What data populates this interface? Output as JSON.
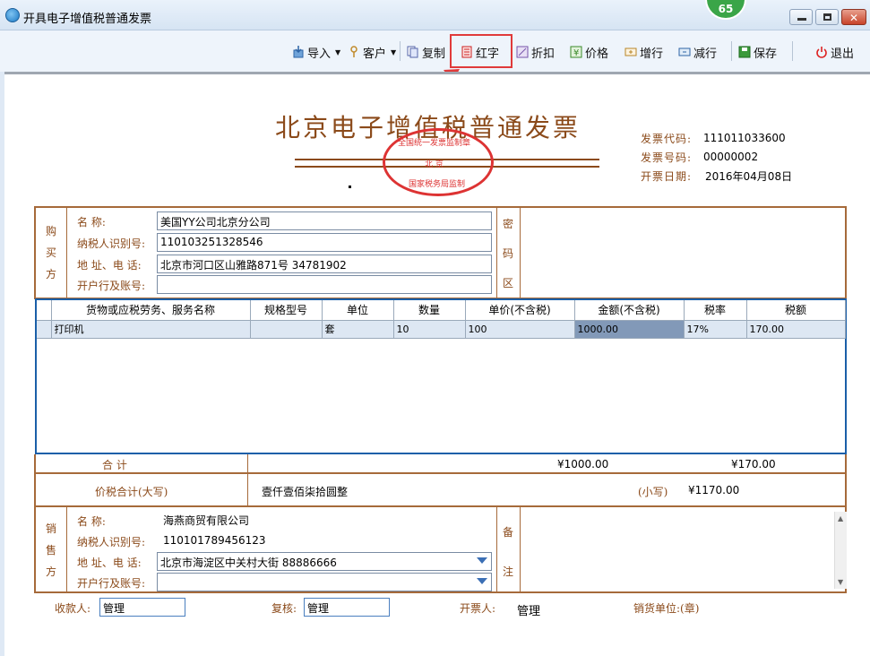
{
  "window": {
    "title": "开具电子增值税普通发票",
    "badge": "65"
  },
  "toolbar": {
    "import": "导入",
    "customer": "客户",
    "copy": "复制",
    "red": "红字",
    "discount": "折扣",
    "price": "价格",
    "add_row": "增行",
    "del_row": "减行",
    "save": "保存",
    "exit": "退出"
  },
  "invoice": {
    "title": "北京电子增值税普通发票",
    "seal_top": "全国统一发票监制章",
    "seal_mid": "北  京",
    "seal_bottom": "国家税务局监制",
    "code_label": "发票代码:",
    "code": "111011033600",
    "number_label": "发票号码:",
    "number": "00000002",
    "date_label": "开票日期:",
    "date": "2016年04月08日"
  },
  "buyer": {
    "section": [
      "购",
      "买",
      "方"
    ],
    "name_label": "名        称:",
    "name": "美国YY公司北京分公司",
    "taxid_label": "纳税人识别号:",
    "taxid": "110103251328546",
    "addr_label": "地 址、电 话:",
    "addr": "北京市河口区山雅路871号 34781902",
    "bank_label": "开户行及账号:",
    "bank": ""
  },
  "cipher": [
    "密",
    "码",
    "区"
  ],
  "grid": {
    "headers": [
      "货物或应税劳务、服务名称",
      "规格型号",
      "单位",
      "数量",
      "单价(不含税)",
      "金额(不含税)",
      "税率",
      "税额"
    ],
    "rows": [
      [
        "打印机",
        "",
        "套",
        "10",
        "100",
        "1000.00",
        "17%",
        "170.00"
      ]
    ]
  },
  "totals": {
    "label": "合          计",
    "amount": "¥1000.00",
    "tax": "¥170.00",
    "big_label": "价税合计(大写)",
    "big_value": "壹仟壹佰柒拾圆整",
    "small_label": "(小写)",
    "small_value": "¥1170.00"
  },
  "seller": {
    "section": [
      "销",
      "售",
      "方"
    ],
    "name_label": "名        称:",
    "name": "海燕商贸有限公司",
    "taxid_label": "纳税人识别号:",
    "taxid": "110101789456123",
    "addr_label": "地 址、电 话:",
    "addr": "北京市海淀区中关村大街 88886666",
    "bank_label": "开户行及账号:",
    "bank": ""
  },
  "remark": [
    "备",
    "注"
  ],
  "signatures": {
    "payee_label": "收款人:",
    "payee": "管理",
    "reviewer_label": "复核:",
    "reviewer": "管理",
    "issuer_label": "开票人:",
    "issuer": "管理",
    "seller_seal_label": "销货单位:(章)"
  }
}
